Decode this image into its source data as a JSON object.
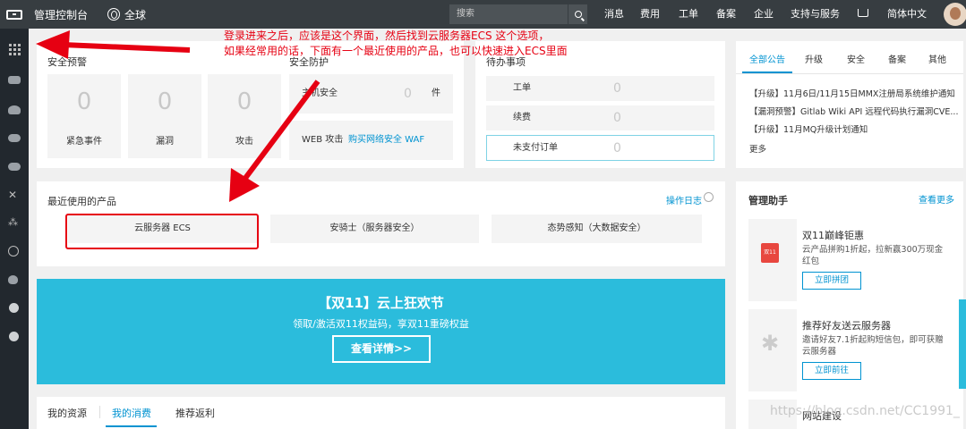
{
  "topbar": {
    "title": "管理控制台",
    "region": "全球",
    "search_placeholder": "搜索",
    "nav": [
      "消息",
      "费用",
      "工单",
      "备案",
      "企业",
      "支持与服务",
      "简体中文"
    ]
  },
  "annotation": {
    "line1": "登录进来之后，应该是这个界面，然后找到云服务器ECS 这个选项，",
    "line2": "如果经常用的话，下面有一个最近使用的产品，也可以快速进入ECS里面"
  },
  "security_warning": {
    "title": "安全预警",
    "tiles": [
      {
        "value": "0",
        "label": "紧急事件"
      },
      {
        "value": "0",
        "label": "漏洞"
      },
      {
        "value": "0",
        "label": "攻击"
      }
    ]
  },
  "security_protection": {
    "title": "安全防护",
    "host_label": "主机安全",
    "host_value": "0",
    "host_unit": "件",
    "web_label": "WEB 攻击",
    "web_link": "购买网络安全 WAF"
  },
  "todo": {
    "title": "待办事项",
    "items": [
      {
        "label": "工单",
        "value": "0"
      },
      {
        "label": "续费",
        "value": "0"
      },
      {
        "label": "未支付订单",
        "value": "0"
      }
    ]
  },
  "recent_products": {
    "title": "最近使用的产品",
    "log_link": "操作日志",
    "items": [
      "云服务器 ECS",
      "安骑士（服务器安全）",
      "态势感知（大数据安全）"
    ]
  },
  "banner": {
    "title": "【双11】云上狂欢节",
    "subtitle": "领取/激活双11权益码，享双11重磅权益",
    "button": "查看详情>>"
  },
  "bottom_tabs": [
    "我的资源",
    "我的消费",
    "推荐返利"
  ],
  "notices": {
    "tabs": [
      "全部公告",
      "升级",
      "安全",
      "备案",
      "其他"
    ],
    "items": [
      "【升级】11月6日/11月15日MMX注册局系统维护通知",
      "【漏洞预警】Gitlab Wiki API 远程代码执行漏洞CVE...",
      "【升级】11月MQ升级计划通知"
    ],
    "more": "更多"
  },
  "assistant": {
    "title": "管理助手",
    "more": "查看更多",
    "promos": [
      {
        "title": "双11巅峰钜惠",
        "desc": "云产品拼购1折起，拉新赢300万现金红包",
        "button": "立即拼团",
        "badge": "双11"
      },
      {
        "title": "推荐好友送云服务器",
        "desc": "邀请好友7.1折起购短信包，即可获赠云服务器",
        "button": "立即前往"
      },
      {
        "title": "网站建设",
        "desc": "",
        "button": ""
      }
    ]
  },
  "watermark": "https://blog.csdn.net/CC1991_"
}
